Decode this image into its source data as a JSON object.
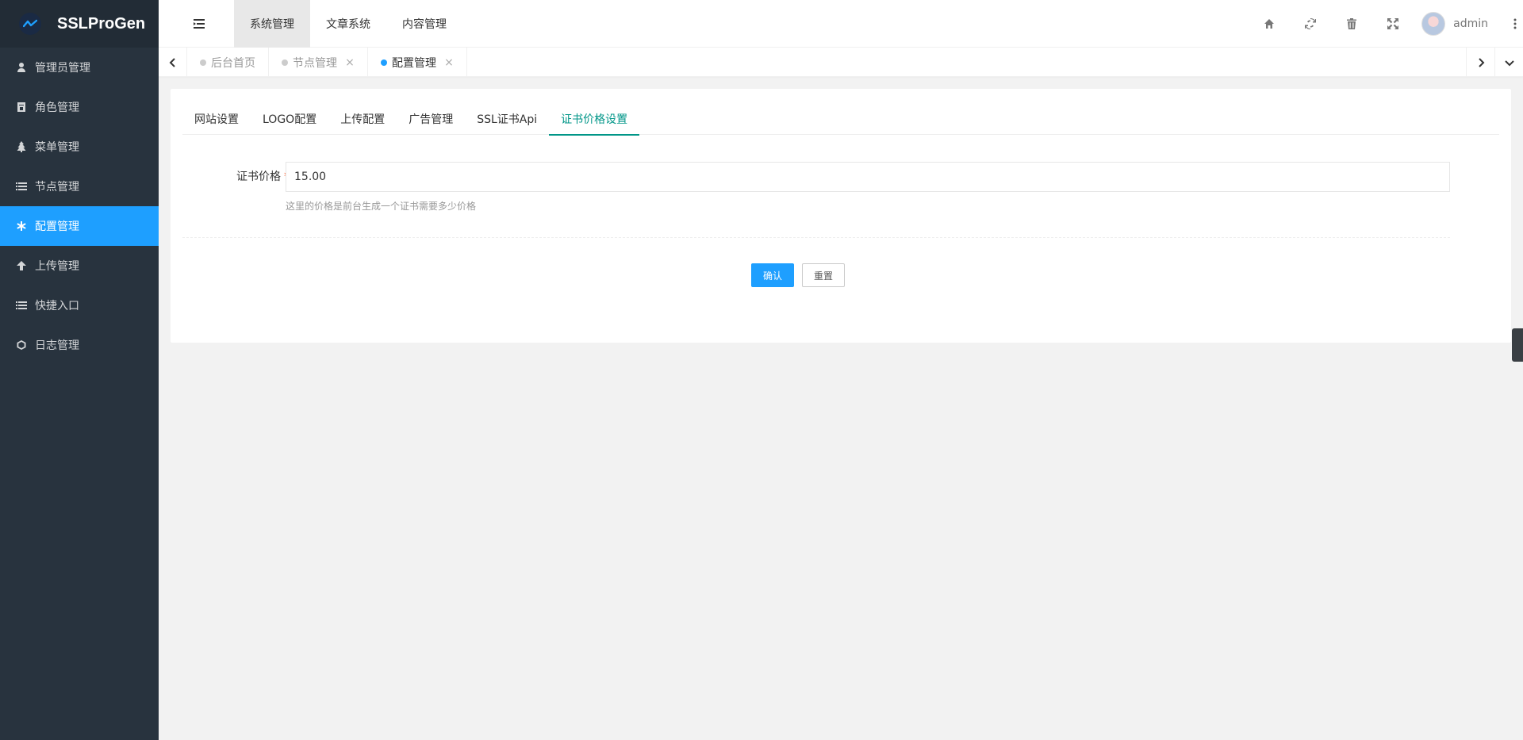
{
  "brand": {
    "name": "SSLProGen",
    "accent": "#1e9fff"
  },
  "sidebar": {
    "items": [
      {
        "label": "管理员管理",
        "icon": "user-icon",
        "active": false
      },
      {
        "label": "角色管理",
        "icon": "role-icon",
        "active": false
      },
      {
        "label": "菜单管理",
        "icon": "tree-icon",
        "active": false
      },
      {
        "label": "节点管理",
        "icon": "list-icon",
        "active": false
      },
      {
        "label": "配置管理",
        "icon": "asterisk-icon",
        "active": true
      },
      {
        "label": "上传管理",
        "icon": "arrow-up-icon",
        "active": false
      },
      {
        "label": "快捷入口",
        "icon": "list-icon",
        "active": false
      },
      {
        "label": "日志管理",
        "icon": "log-icon",
        "active": false
      }
    ]
  },
  "header": {
    "nav": [
      {
        "label": "系统管理",
        "active": true
      },
      {
        "label": "文章系统",
        "active": false
      },
      {
        "label": "内容管理",
        "active": false
      }
    ],
    "icons": [
      "home-icon",
      "refresh-icon",
      "trash-icon",
      "fullscreen-icon"
    ],
    "user": {
      "name": "admin"
    }
  },
  "tabs": [
    {
      "label": "后台首页",
      "active": false,
      "closable": false
    },
    {
      "label": "节点管理",
      "active": false,
      "closable": true
    },
    {
      "label": "配置管理",
      "active": true,
      "closable": true
    }
  ],
  "config": {
    "subtabs": [
      {
        "label": "网站设置",
        "active": false
      },
      {
        "label": "LOGO配置",
        "active": false
      },
      {
        "label": "上传配置",
        "active": false
      },
      {
        "label": "广告管理",
        "active": false
      },
      {
        "label": "SSL证书Api",
        "active": false
      },
      {
        "label": "证书价格设置",
        "active": true
      }
    ],
    "field": {
      "label": "证书价格",
      "required_mark": "*",
      "value": "15.00",
      "tip": "这里的价格是前台生成一个证书需要多少价格"
    },
    "buttons": {
      "confirm": "确认",
      "reset": "重置"
    }
  }
}
